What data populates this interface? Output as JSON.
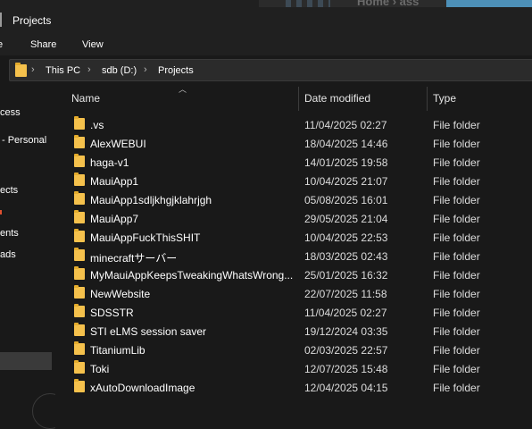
{
  "window": {
    "title": "Projects",
    "background_window_text": "Home › ass"
  },
  "ribbon": {
    "home_label": "e",
    "share_label": "Share",
    "view_label": "View"
  },
  "address": {
    "crumbs": [
      "This PC",
      "sdb (D:)",
      "Projects"
    ],
    "separator": "›"
  },
  "sidebar": {
    "items": [
      "cess",
      "- Personal",
      "ects",
      "ents",
      "ads"
    ]
  },
  "columns": {
    "name": "Name",
    "date": "Date modified",
    "type": "Type"
  },
  "files": [
    {
      "name": ".vs",
      "date": "11/04/2025 02:27",
      "type": "File folder"
    },
    {
      "name": "AlexWEBUI",
      "date": "18/04/2025 14:46",
      "type": "File folder"
    },
    {
      "name": "haga-v1",
      "date": "14/01/2025 19:58",
      "type": "File folder"
    },
    {
      "name": "MauiApp1",
      "date": "10/04/2025 21:07",
      "type": "File folder"
    },
    {
      "name": "MauiApp1sdljkhgjklahrjgh",
      "date": "05/08/2025 16:01",
      "type": "File folder"
    },
    {
      "name": "MauiApp7",
      "date": "29/05/2025 21:04",
      "type": "File folder"
    },
    {
      "name": "MauiAppFuckThisSHIT",
      "date": "10/04/2025 22:53",
      "type": "File folder"
    },
    {
      "name": "minecraftサーバー",
      "date": "18/03/2025 02:43",
      "type": "File folder"
    },
    {
      "name": "MyMauiAppKeepsTweakingWhatsWrong...",
      "date": "25/01/2025 16:32",
      "type": "File folder"
    },
    {
      "name": "NewWebsite",
      "date": "22/07/2025 11:58",
      "type": "File folder"
    },
    {
      "name": "SDSSTR",
      "date": "11/04/2025 02:27",
      "type": "File folder"
    },
    {
      "name": "STI eLMS session saver",
      "date": "19/12/2024 03:35",
      "type": "File folder"
    },
    {
      "name": "TitaniumLib",
      "date": "02/03/2025 22:57",
      "type": "File folder"
    },
    {
      "name": "Toki",
      "date": "12/07/2025 15:48",
      "type": "File folder"
    },
    {
      "name": "xAutoDownloadImage",
      "date": "12/04/2025 04:15",
      "type": "File folder"
    }
  ],
  "colors": {
    "background": "#191919",
    "chrome": "#202020",
    "folder": "#f5c14c",
    "selection": "#3a3a3a"
  }
}
